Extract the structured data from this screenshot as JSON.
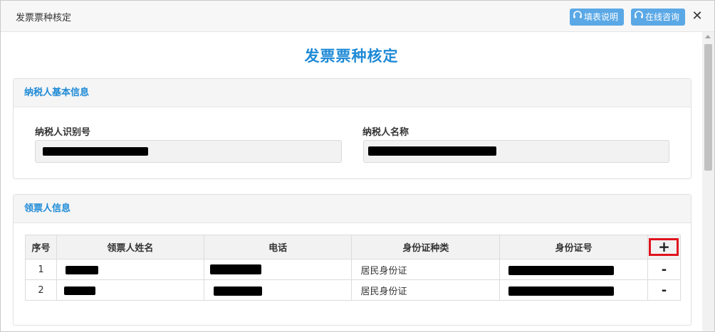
{
  "window": {
    "title": "发票票种核定",
    "buttons": {
      "guide_label": "填表说明",
      "consult_label": "在线咨询"
    },
    "close_glyph": "✕"
  },
  "page_title": "发票票种核定",
  "taxpayer_panel": {
    "header": "纳税人基本信息",
    "id_label": "纳税人识别号",
    "name_label": "纳税人名称"
  },
  "recipient_panel": {
    "header": "领票人信息",
    "columns": [
      "序号",
      "领票人姓名",
      "电话",
      "身份证种类",
      "身份证号"
    ],
    "add_glyph": "+",
    "rows": [
      {
        "index": "1",
        "id_type": "居民身份证",
        "remove_glyph": "-"
      },
      {
        "index": "2",
        "id_type": "居民身份证",
        "remove_glyph": "-"
      }
    ]
  },
  "colors": {
    "accent": "#1e8ad6",
    "button": "#5aa8e6",
    "highlight": "#e0141e"
  },
  "icons": {
    "guide": "headset-icon",
    "consult": "headset-icon"
  }
}
